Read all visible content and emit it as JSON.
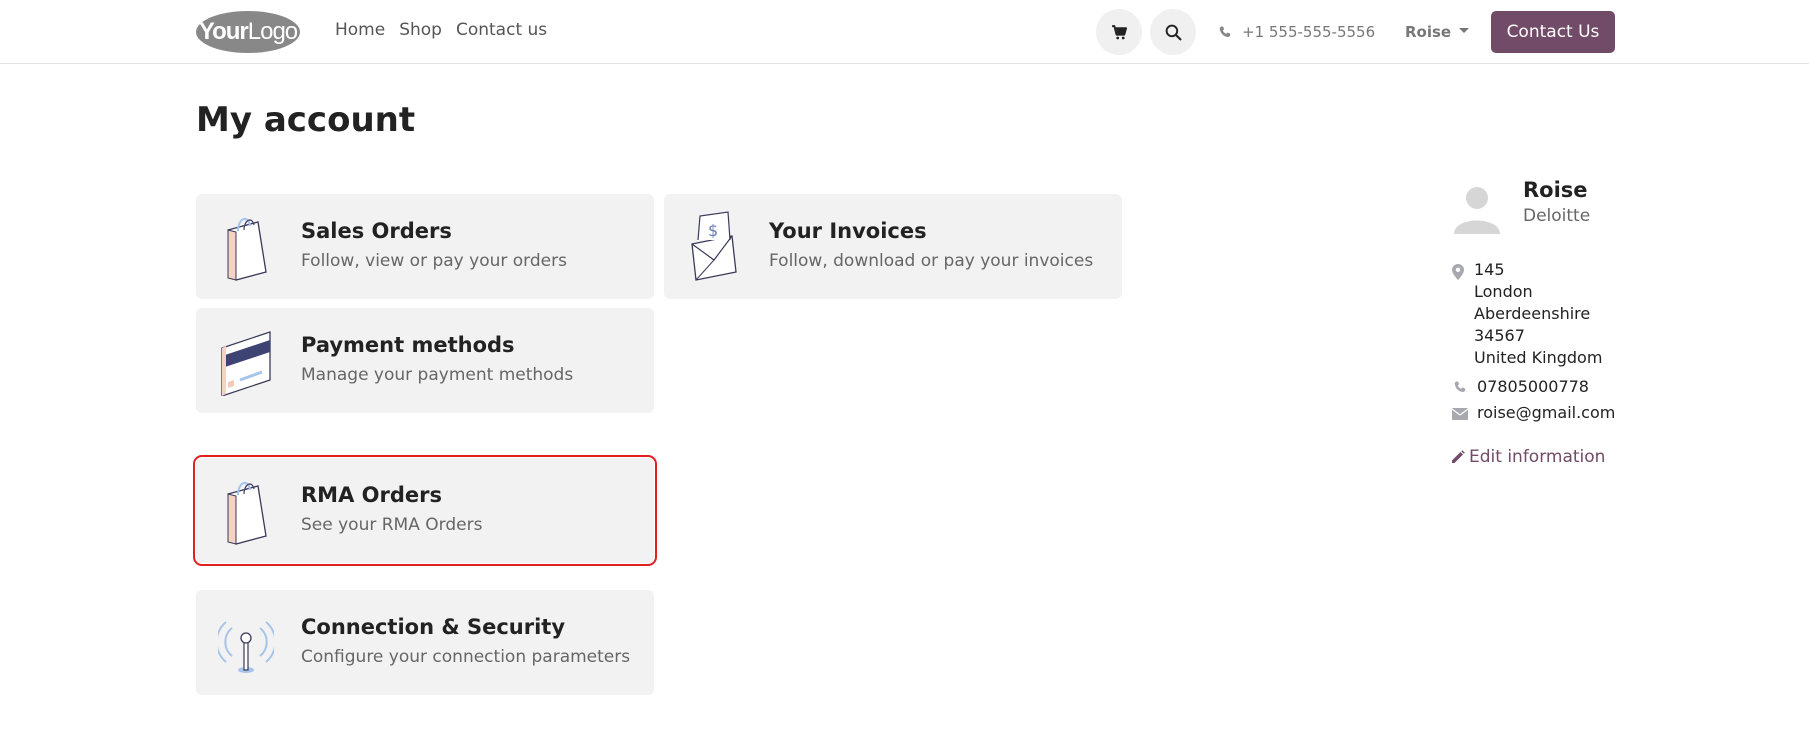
{
  "header": {
    "logo_bold": "Your",
    "logo_light": "Logo",
    "nav": [
      "Home",
      "Shop",
      "Contact us"
    ],
    "phone": "+1 555-555-5556",
    "user": "Roise",
    "cta": "Contact Us",
    "icons": [
      "cart-icon",
      "search-icon",
      "phone-icon"
    ]
  },
  "page": {
    "title": "My account"
  },
  "cards": [
    {
      "title": "Sales Orders",
      "desc": "Follow, view or pay your orders",
      "icon": "shopping-bag-icon"
    },
    {
      "title": "Your Invoices",
      "desc": "Follow, download or pay your invoices",
      "icon": "invoice-envelope-icon"
    },
    {
      "title": "Payment methods",
      "desc": "Manage your payment methods",
      "icon": "credit-card-icon"
    },
    {
      "title": "RMA Orders",
      "desc": "See your RMA Orders",
      "icon": "shopping-bag-icon"
    },
    {
      "title": "Connection & Security",
      "desc": "Configure your connection parameters",
      "icon": "antenna-icon"
    }
  ],
  "profile": {
    "name": "Roise",
    "company": "Deloitte",
    "address": [
      "145",
      "London",
      "Aberdeenshire",
      "34567",
      "United Kingdom"
    ],
    "phone": "07805000778",
    "email": "roise@gmail.com",
    "edit_label": "Edit information"
  },
  "colors": {
    "brand": "#714b67",
    "highlight": "#e02020",
    "card_bg": "#f2f2f2"
  }
}
